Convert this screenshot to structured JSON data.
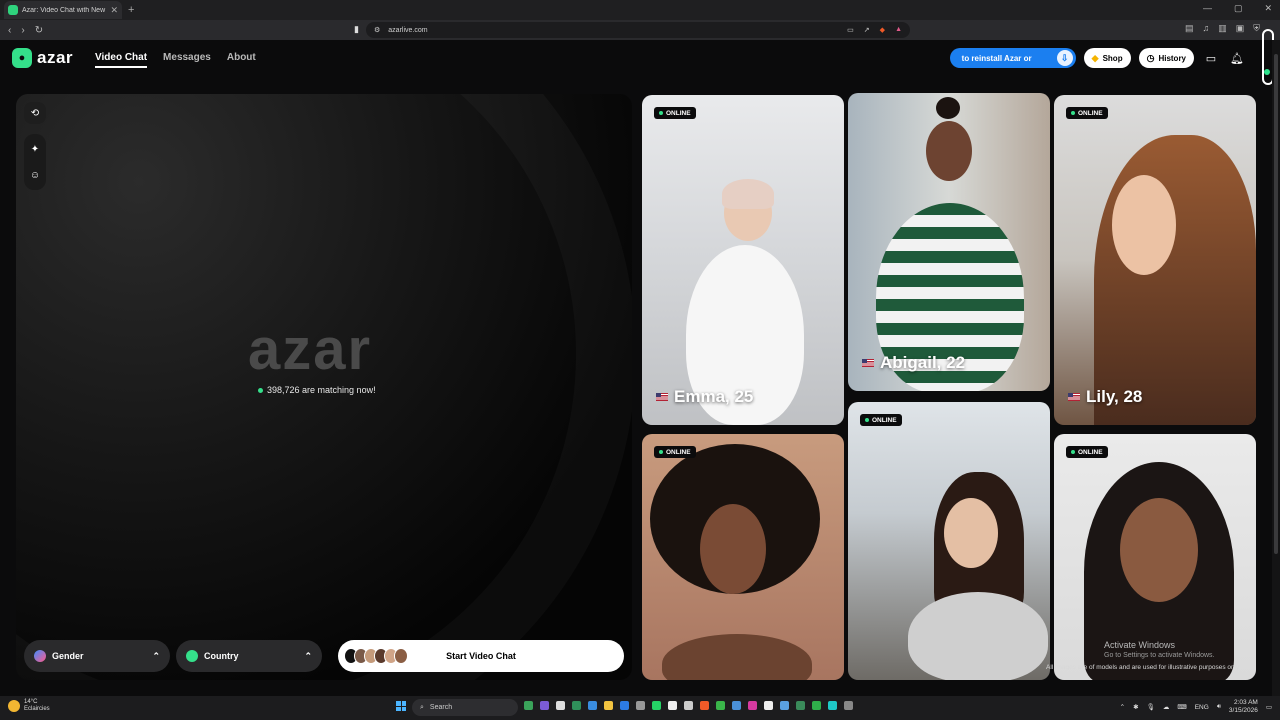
{
  "browser": {
    "tab_title": "Azar: Video Chat with New Peop",
    "url": "azarlive.com"
  },
  "header": {
    "logo_text": "azar",
    "nav": [
      {
        "label": "Video Chat",
        "active": true
      },
      {
        "label": "Messages",
        "active": false
      },
      {
        "label": "About",
        "active": false
      }
    ],
    "reinstall_label": "to reinstall Azar or",
    "shop_label": "Shop",
    "history_label": "History"
  },
  "stage": {
    "brand_word": "azar",
    "matching_text": "398,726 are matching now!",
    "gender_label": "Gender",
    "country_label": "Country",
    "start_label": "Start Video Chat"
  },
  "profiles": [
    {
      "name": "Emma, 25",
      "status": "ONLINE",
      "country": "us"
    },
    {
      "name": "Abigail, 22",
      "status": "",
      "country": "us"
    },
    {
      "name": "Lily, 28",
      "status": "ONLINE",
      "country": "us"
    },
    {
      "name": "",
      "status": "ONLINE",
      "country": ""
    },
    {
      "name": "",
      "status": "ONLINE",
      "country": ""
    },
    {
      "name": "",
      "status": "ONLINE",
      "country": ""
    }
  ],
  "overlay": {
    "activate_title": "Activate Windows",
    "activate_sub": "Go to Settings to activate Windows.",
    "disclaimer": "All images are of models and are used for illustrative purposes only"
  },
  "taskbar": {
    "weather_temp": "14°C",
    "weather_desc": "Eclaircies",
    "search_label": "Search",
    "lang": "ENG",
    "time": "2:03 AM",
    "date": "3/15/2026"
  },
  "colors": {
    "accent_green": "#35e08b",
    "reinstall_blue": "#1b7ff0",
    "background": "#0b0b0c"
  }
}
